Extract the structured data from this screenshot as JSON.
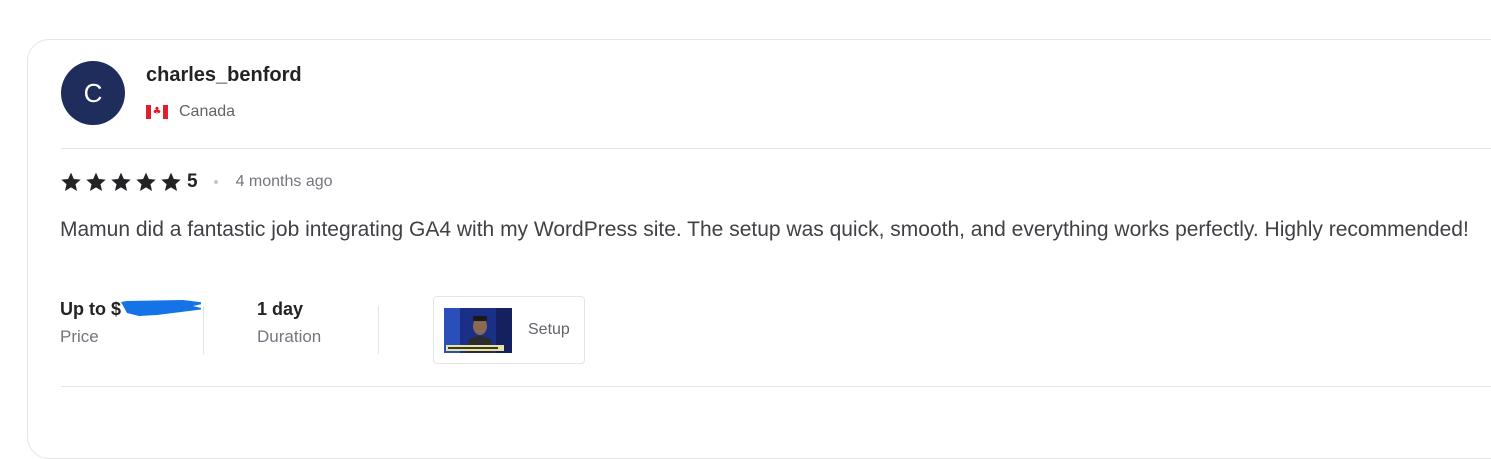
{
  "reviewer": {
    "avatar_letter": "C",
    "avatar_color": "#1f2d5c",
    "username": "charles_benford",
    "country": "Canada",
    "flag_icon": "canada-flag-icon"
  },
  "review": {
    "rating": 5,
    "rating_label": "5",
    "star_color": "#222325",
    "time_ago": "4 months ago",
    "text": "Mamun did a fantastic job integrating GA4 with my WordPress site. The setup was quick, smooth, and everything works perfectly. Highly recommended!"
  },
  "meta": {
    "price_value": "Up to $",
    "price_label": "Price",
    "duration_value": "1 day",
    "duration_label": "Duration",
    "deliverable_label": "Setup"
  },
  "colors": {
    "redaction_blue": "#1473e6"
  }
}
